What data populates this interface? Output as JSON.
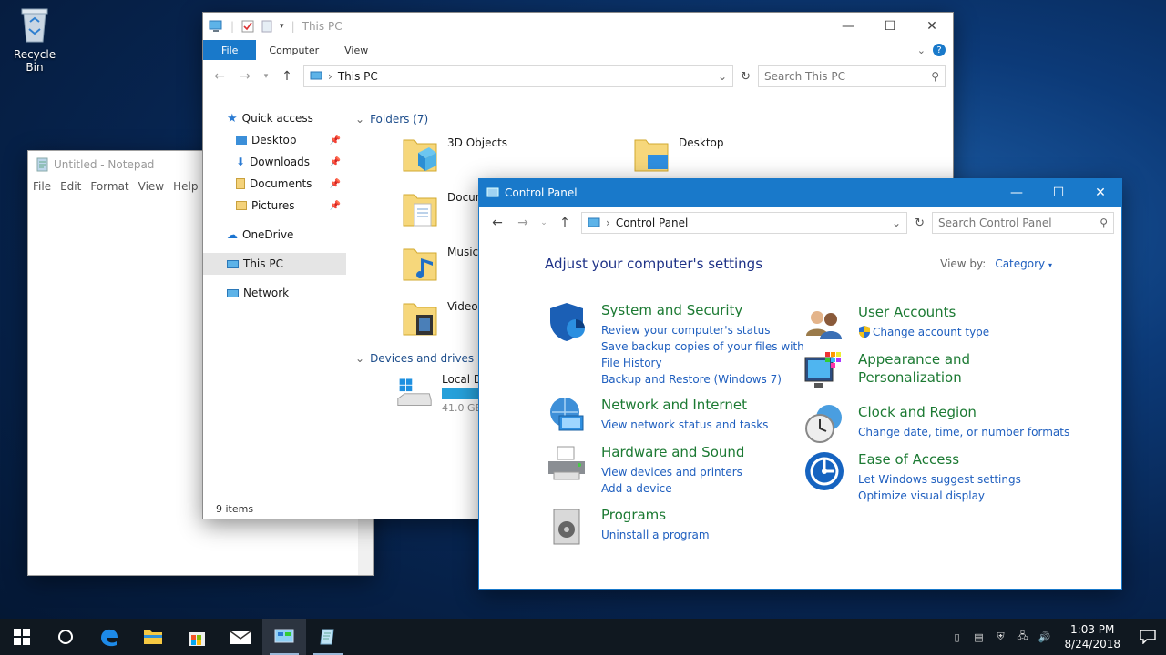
{
  "desktop": {
    "recycle_bin": "Recycle Bin"
  },
  "notepad": {
    "title": "Untitled - Notepad",
    "menu": [
      "File",
      "Edit",
      "Format",
      "View",
      "Help"
    ]
  },
  "explorer": {
    "title": "This PC",
    "ribbon_tabs": [
      "File",
      "Computer",
      "View"
    ],
    "address": "This PC",
    "search_placeholder": "Search This PC",
    "nav": {
      "quick_access": "Quick access",
      "desktop": "Desktop",
      "downloads": "Downloads",
      "documents": "Documents",
      "pictures": "Pictures",
      "onedrive": "OneDrive",
      "this_pc": "This PC",
      "network": "Network"
    },
    "folders_header": "Folders (7)",
    "folders": [
      "3D Objects",
      "Desktop",
      "Docum",
      "Music",
      "Videos"
    ],
    "devices_header": "Devices and drives (2)",
    "drive_name": "Local D",
    "drive_free": "41.0 GE",
    "status": "9 items"
  },
  "control_panel": {
    "title": "Control Panel",
    "address": "Control Panel",
    "search_placeholder": "Search Control Panel",
    "heading": "Adjust your computer's settings",
    "view_by_label": "View by:",
    "view_by_value": "Category",
    "categories": {
      "system": {
        "title": "System and Security",
        "links": [
          "Review your computer's status",
          "Save backup copies of your files with",
          "File History",
          "Backup and Restore (Windows 7)"
        ]
      },
      "network": {
        "title": "Network and Internet",
        "links": [
          "View network status and tasks"
        ]
      },
      "hardware": {
        "title": "Hardware and Sound",
        "links": [
          "View devices and printers",
          "Add a device"
        ]
      },
      "programs": {
        "title": "Programs",
        "links": [
          "Uninstall a program"
        ]
      },
      "users": {
        "title": "User Accounts",
        "links": [
          "Change account type"
        ]
      },
      "appearance": {
        "title": "Appearance and",
        "title2": "Personalization",
        "links": []
      },
      "clock": {
        "title": "Clock and Region",
        "links": [
          "Change date, time, or number formats"
        ]
      },
      "ease": {
        "title": "Ease of Access",
        "links": [
          "Let Windows suggest settings",
          "Optimize visual display"
        ]
      }
    }
  },
  "taskbar": {
    "time": "1:03 PM",
    "date": "8/24/2018"
  },
  "colors": {
    "accent": "#1979ca",
    "cp_green": "#1c7a33",
    "link_blue": "#1f5fbf",
    "heading_blue": "#1e3287"
  }
}
